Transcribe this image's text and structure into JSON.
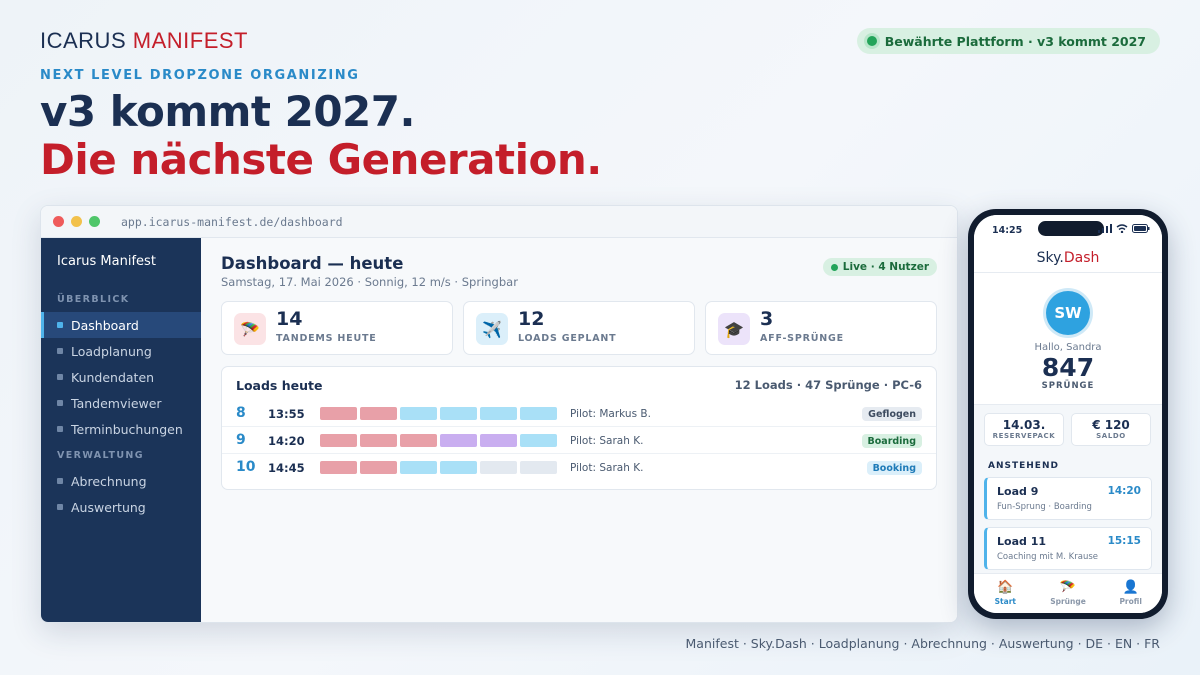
{
  "brand": {
    "part1": "ICARUS",
    "part2": "MANIFEST"
  },
  "badge": "Bewährte Plattform · v3 kommt 2027",
  "kicker": "NEXT LEVEL DROPZONE ORGANIZING",
  "headline1": "v3 kommt 2027.",
  "headline2": "Die nächste Generation.",
  "browser": {
    "url": "app.icarus-manifest.de/dashboard"
  },
  "sidebar": {
    "title": "Icarus Manifest",
    "section1": "ÜBERBLICK",
    "section2": "VERWALTUNG",
    "items1": [
      "Dashboard",
      "Loadplanung",
      "Kundendaten",
      "Tandemviewer",
      "Terminbuchungen"
    ],
    "items2": [
      "Abrechnung",
      "Auswertung"
    ]
  },
  "dashboard": {
    "title": "Dashboard — heute",
    "subtitle": "Samstag, 17. Mai 2026 · Sonnig, 12 m/s · Springbar",
    "live": "Live · 4 Nutzer",
    "stats": [
      {
        "icon": "🪂",
        "value": "14",
        "label": "TANDEMS HEUTE"
      },
      {
        "icon": "✈️",
        "value": "12",
        "label": "LOADS GEPLANT"
      },
      {
        "icon": "🎓",
        "value": "3",
        "label": "AFF-SPRÜNGE"
      }
    ],
    "loads_title": "Loads heute",
    "loads_summary": "12 Loads · 47 Sprünge · PC-6",
    "loads": [
      {
        "no": "8",
        "time": "13:55",
        "pilot": "Pilot: Markus B.",
        "status": "Geflogen",
        "slots": [
          "tandem",
          "tandem",
          "fun",
          "fun",
          "fun",
          "fun"
        ]
      },
      {
        "no": "9",
        "time": "14:20",
        "pilot": "Pilot: Sarah K.",
        "status": "Boarding",
        "slots": [
          "tandem",
          "tandem",
          "tandem",
          "aff",
          "aff",
          "fun"
        ]
      },
      {
        "no": "10",
        "time": "14:45",
        "pilot": "Pilot: Sarah K.",
        "status": "Booking",
        "slots": [
          "tandem",
          "tandem",
          "fun",
          "fun",
          "free",
          "free"
        ]
      }
    ]
  },
  "colors": {
    "tandem": "#e8a0a8",
    "fun": "#a9e0f7",
    "aff": "#c9aef0",
    "free": "#e3e9f0"
  },
  "phone": {
    "time": "14:25",
    "app": {
      "part1": "Sky.",
      "part2": "Dash"
    },
    "initials": "SW",
    "greeting": "Hallo, Sandra",
    "jumps": "847",
    "jumps_label": "SPRÜNGE",
    "reserve": {
      "value": "14.03.",
      "label": "RESERVEPACK"
    },
    "saldo": {
      "value": "€ 120",
      "label": "SALDO"
    },
    "upcoming_title": "ANSTEHEND",
    "upcoming": [
      {
        "title": "Load 9",
        "time": "14:20",
        "desc": "Fun-Sprung · Boarding"
      },
      {
        "title": "Load 11",
        "time": "15:15",
        "desc": "Coaching mit M. Krause"
      }
    ],
    "tabs": [
      {
        "icon": "🏠",
        "label": "Start"
      },
      {
        "icon": "🪂",
        "label": "Sprünge"
      },
      {
        "icon": "👤",
        "label": "Profil"
      }
    ]
  },
  "footer": "Manifest · Sky.Dash · Loadplanung · Abrechnung · Auswertung · DE · EN · FR"
}
